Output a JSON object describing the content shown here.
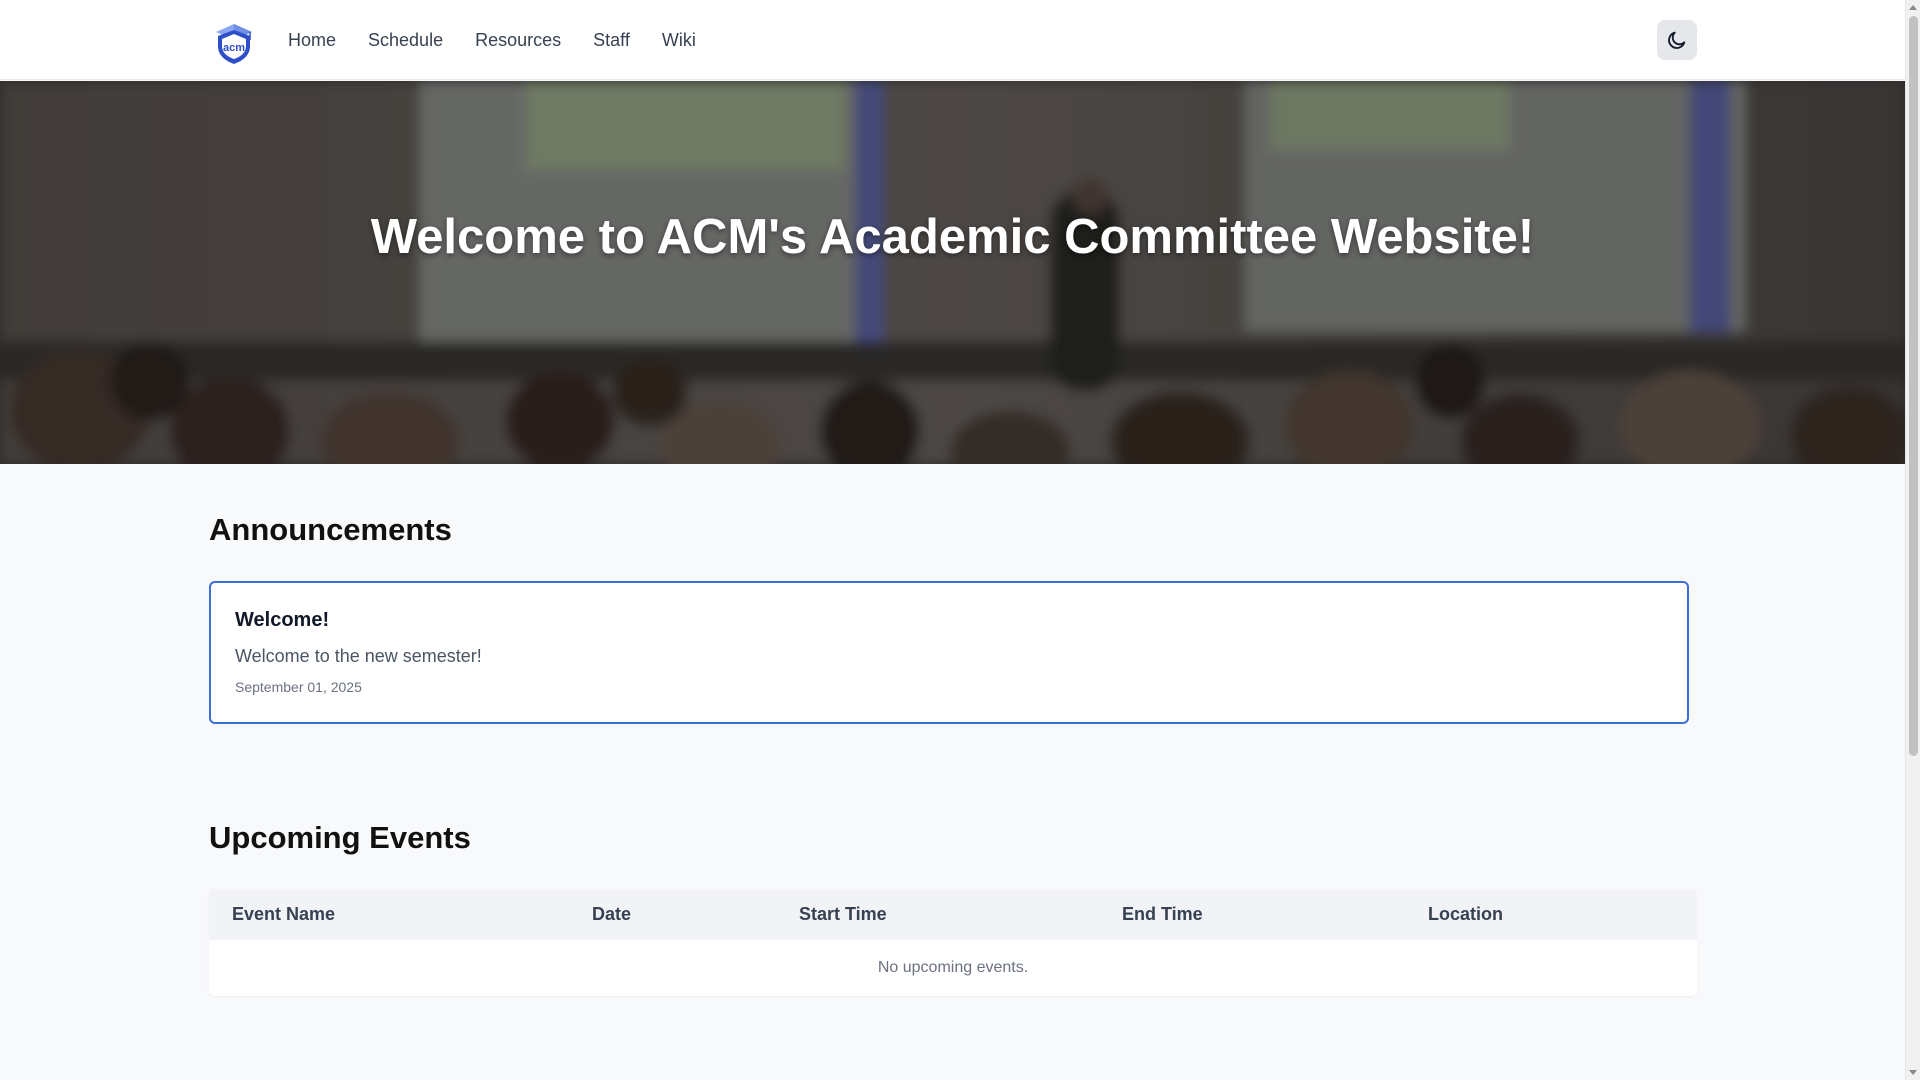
{
  "nav": {
    "logo_text": "acm",
    "links": [
      {
        "label": "Home"
      },
      {
        "label": "Schedule"
      },
      {
        "label": "Resources"
      },
      {
        "label": "Staff"
      },
      {
        "label": "Wiki"
      }
    ],
    "theme_toggle_icon": "moon-icon"
  },
  "hero": {
    "title": "Welcome to ACM's Academic Committee Website!"
  },
  "announcements": {
    "heading": "Announcements",
    "items": [
      {
        "title": "Welcome!",
        "body": "Welcome to the new semester!",
        "date": "September 01, 2025"
      }
    ]
  },
  "events": {
    "heading": "Upcoming Events",
    "columns": [
      "Event Name",
      "Date",
      "Start Time",
      "End Time",
      "Location"
    ],
    "empty_message": "No upcoming events."
  },
  "colors": {
    "accent": "#3b6fd4",
    "logo_blue": "#2f4fc9"
  }
}
